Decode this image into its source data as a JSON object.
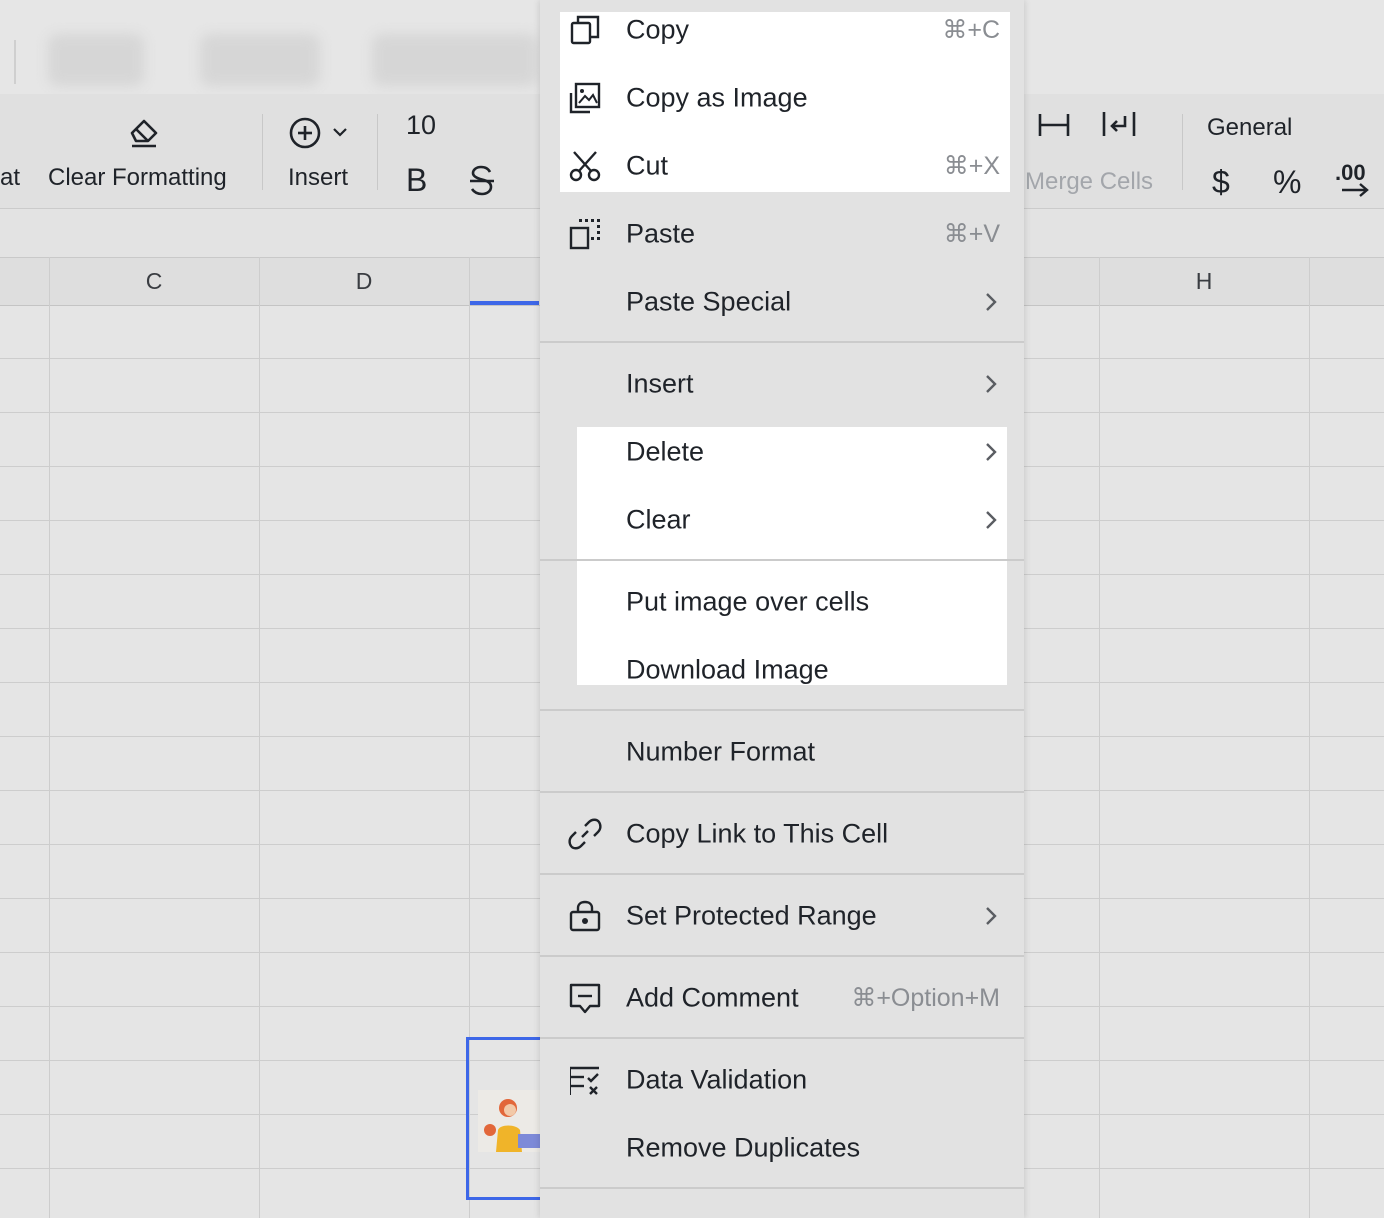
{
  "toolbar": {
    "partial_left_label": "at",
    "clear_formatting_label": "Clear Formatting",
    "insert_label": "Insert",
    "font_size": "10",
    "bold_label": "B",
    "merge_cells_label": "Merge Cells",
    "number_format_value": "General",
    "currency_label": "$",
    "percent_label": "%",
    "decimal_label": ".00"
  },
  "columns": [
    "C",
    "D",
    "H"
  ],
  "menu": {
    "copy": {
      "label": "Copy",
      "shortcut": "⌘+C"
    },
    "copy_as_image": {
      "label": "Copy as Image"
    },
    "cut": {
      "label": "Cut",
      "shortcut": "⌘+X"
    },
    "paste": {
      "label": "Paste",
      "shortcut": "⌘+V"
    },
    "paste_special": {
      "label": "Paste Special"
    },
    "insert": {
      "label": "Insert"
    },
    "delete": {
      "label": "Delete"
    },
    "clear": {
      "label": "Clear"
    },
    "put_image_over_cells": {
      "label": "Put image over cells"
    },
    "download_image": {
      "label": "Download Image"
    },
    "number_format": {
      "label": "Number Format"
    },
    "copy_link": {
      "label": "Copy Link to This Cell"
    },
    "set_protected_range": {
      "label": "Set Protected Range"
    },
    "add_comment": {
      "label": "Add Comment",
      "shortcut": "⌘+Option+M"
    },
    "data_validation": {
      "label": "Data Validation"
    },
    "remove_duplicates": {
      "label": "Remove Duplicates"
    }
  },
  "colors": {
    "accent": "#3d67e8",
    "menu_bg": "#e2e2e2",
    "highlight": "#ffffff"
  }
}
